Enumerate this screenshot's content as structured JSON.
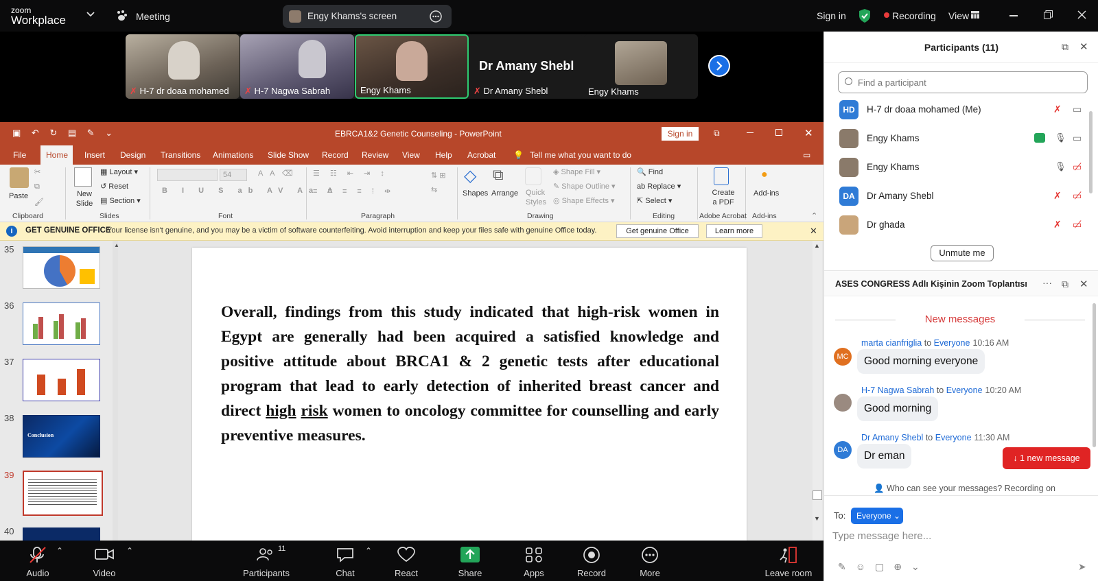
{
  "zoom": {
    "logo_top": "zoom",
    "logo_bottom": "Workplace",
    "meeting_label": "Meeting",
    "share_label": "Engy Khams's screen",
    "sign_in": "Sign in",
    "recording": "Recording",
    "view": "View"
  },
  "videos": [
    {
      "name": "H-7 dr doaa mohamed",
      "muted": true
    },
    {
      "name": "H-7 Nagwa Sabrah",
      "muted": true
    },
    {
      "name": "Engy Khams",
      "muted": false
    },
    {
      "name": "Dr Amany Shebl",
      "muted": true,
      "title": "Dr Amany Shebl"
    },
    {
      "name": "Engy Khams",
      "muted": false
    }
  ],
  "ppt": {
    "title": "EBRCA1&2 Genetic Counseling  -  PowerPoint",
    "sign_in": "Sign in",
    "tabs": [
      "File",
      "Home",
      "Insert",
      "Design",
      "Transitions",
      "Animations",
      "Slide Show",
      "Record",
      "Review",
      "View",
      "Help",
      "Acrobat",
      "Tell me what you want to do"
    ],
    "ribbon": {
      "paste": "Paste",
      "new_slide": "New Slide",
      "layout": "Layout",
      "reset": "Reset",
      "section": "Section",
      "font_size": "54",
      "shapes": "Shapes",
      "arrange": "Arrange",
      "quick_styles": "Quick Styles",
      "shape_fill": "Shape Fill",
      "shape_outline": "Shape Outline",
      "shape_effects": "Shape Effects",
      "find": "Find",
      "replace": "Replace",
      "select": "Select",
      "create_pdf": "Create a PDF",
      "addins": "Add-ins",
      "groups": [
        "Clipboard",
        "Slides",
        "Font",
        "Paragraph",
        "Drawing",
        "Editing",
        "Adobe Acrobat",
        "Add-ins"
      ]
    },
    "notice": {
      "title": "GET GENUINE OFFICE",
      "text": "Your license isn't genuine, and you may be a victim of software counterfeiting. Avoid interruption and keep your files safe with genuine Office today.",
      "btn1": "Get genuine Office",
      "btn2": "Learn more"
    },
    "thumbs": [
      "35",
      "36",
      "37",
      "38",
      "39",
      "40"
    ],
    "thumb38_label": "Conclusion",
    "slide_text_a": "Overall, findings from this study indicated that high-risk women in Egypt are generally had been acquired a satisfied  knowledge and positive attitude about BRCA1 & 2 genetic tests after educational program that lead to early detection of inherited breast cancer and direct ",
    "slide_text_u1": "high",
    "slide_text_u2": "risk",
    "slide_text_b": " women to oncology committee for counselling and early preventive measures."
  },
  "participants": {
    "header": "Participants (11)",
    "search_placeholder": "Find a participant",
    "list": [
      {
        "initials": "HD",
        "name": "H-7 dr doaa mohamed (Me)",
        "color": "#2f7bd6"
      },
      {
        "initials": "",
        "name": "Engy Khams",
        "color": "#8a7a6a"
      },
      {
        "initials": "",
        "name": "Engy Khams",
        "color": "#8a7a6a"
      },
      {
        "initials": "DA",
        "name": "Dr Amany Shebl",
        "color": "#2f7bd6"
      },
      {
        "initials": "",
        "name": "Dr ghada",
        "color": "#c9a57a"
      }
    ],
    "unmute": "Unmute me"
  },
  "chat": {
    "header": "ASES CONGRESS Adlı Kişinin Zoom Toplantısı",
    "new_messages": "New messages",
    "messages": [
      {
        "initials": "MC",
        "sender": "marta cianfriglia",
        "to": "to",
        "target": "Everyone",
        "time": "10:16 AM",
        "text": "Good morning everyone",
        "color": "#e07020"
      },
      {
        "initials": "",
        "sender": "H-7 Nagwa Sabrah",
        "to": "to",
        "target": "Everyone",
        "time": "10:20 AM",
        "text": "Good morning",
        "color": "#9a8a80"
      },
      {
        "initials": "DA",
        "sender": "Dr Amany Shebl",
        "to": "to",
        "target": "Everyone",
        "time": "11:30 AM",
        "text": "Dr eman",
        "color": "#2f7bd6"
      }
    ],
    "new_message_btn": "1 new message",
    "visibility": "Who can see your messages? Recording on",
    "to_label": "To:",
    "to_value": "Everyone",
    "input_placeholder": "Type message here..."
  },
  "bottom": {
    "audio": "Audio",
    "video": "Video",
    "participants": "Participants",
    "participants_count": "11",
    "chat": "Chat",
    "react": "React",
    "share": "Share",
    "apps": "Apps",
    "record": "Record",
    "more": "More",
    "leave": "Leave room"
  }
}
